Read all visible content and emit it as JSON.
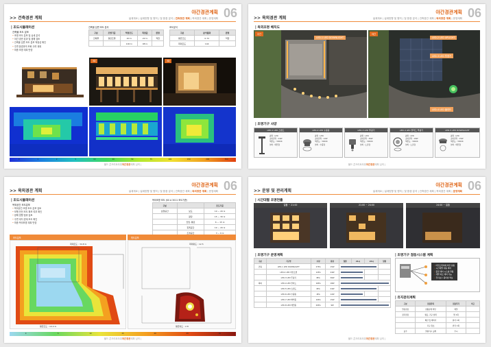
{
  "chapter_title": "야간경관계획",
  "chapter_number": "06",
  "nav": [
    "설계개요",
    "설계방향 및 원칙",
    "빛 환경 분석",
    "건축경관 계획",
    "옥외경관 계획",
    "운영계획"
  ],
  "footer": {
    "prefix": "올드 콘크리트타워",
    "highlight": "야간경관",
    "suffix": "계획 심의",
    "page": "|"
  },
  "page1": {
    "section": ">> 건축경관 계획",
    "sub": "| 조도시뮬레이션",
    "sub2": "건축물 조도 분포",
    "bullets": [
      "조명 조도 분포 및 상세 분석",
      "야간 경관 효과 및 광해 검토",
      "건축물 입면 조도 분포 적정성 확인",
      "주변 환경과의 조화 고려 계획",
      "최종 조명 계획 반영"
    ],
    "table1_title": "건축물 입면 조도 분석",
    "table1_head": [
      "구분",
      "조명기준",
      "적정조도",
      "측정값",
      "판정"
    ],
    "table1_rows": [
      [
        "건축물",
        "경관조명",
        "20 lx",
        "22 lx",
        "적합"
      ],
      [
        "",
        "",
        "100 lx",
        "98 lx",
        ""
      ]
    ],
    "table2_title": "조도분석",
    "table2_head": [
      "구분",
      "분석결과",
      "판정"
    ],
    "table2_rows": [
      [
        "평균조도",
        "0.72",
        "적합"
      ],
      [
        "최대조도",
        "144",
        ""
      ]
    ],
    "scale": [
      "0",
      "1",
      "2",
      "5",
      "10",
      "20",
      "50",
      "75",
      "100",
      "150",
      "200",
      "500"
    ]
  },
  "page2": {
    "section": ">> 옥외경관 계획",
    "sub": "| 옥외조명 배치도",
    "plabel_left": "주간",
    "plabel_right": "야간",
    "callouts": [
      "LED-1 LED DOWNLIGHT",
      "LED-2 LED UPLIGHT",
      "LED-3 LED 투광기",
      "LED-4 LED 볼라드"
    ],
    "sub2": "| 조명기구 사양",
    "cards": [
      {
        "title": "LED-1 LED 스탠드",
        "specs": [
          "광원 : LED",
          "소비전력 : 24W",
          "색온도 : 3000K",
          "설치 : 매입형"
        ]
      },
      {
        "title": "LED-2 LED 수중등",
        "specs": [
          "광원 : LED",
          "소비전력 : 12W",
          "색온도 : 3000K",
          "설치 : 수중형"
        ]
      },
      {
        "title": "LED-3 LED 투광기",
        "specs": [
          "광원 : LED",
          "소비전력 : 36W",
          "색온도 : 3000K",
          "설치 : 노출형"
        ]
      },
      {
        "title": "LED-4 LED 볼라드 투광기",
        "specs": [
          "광원 : LED",
          "소비전력 : 18W",
          "색온도 : 3000K",
          "설치 : 노출형"
        ]
      },
      {
        "title": "LED-5 LED DOWNLIGHT",
        "specs": [
          "광원 : LED",
          "소비전력 : 15W",
          "색온도 : 3000K",
          "설치 : 매입형"
        ]
      }
    ]
  },
  "page3": {
    "section": ">> 옥외경관 계획",
    "sub": "| 조도시뮬레이션",
    "sub2": "옥외공간 조도분포",
    "bullets": [
      "옥외공간 조명 조도 분포 검토",
      "보행 안전 조도 확보 여부 확인",
      "광해 영향 범위 검토",
      "주변 대지 경계 조도 확인",
      "최종 옥외조명 계획 반영"
    ],
    "table_title": "옥외조명 조도 (KS A 3011 조도기준)",
    "table_head": [
      "구분",
      "",
      "조도기준"
    ],
    "table_rows": [
      [
        "보행공간",
        "보도",
        "10 ~ 20 lx"
      ],
      [
        "",
        "광장",
        "15 ~ 30 lx"
      ],
      [
        "",
        "진입, 통로",
        "6 ~ 15 lx"
      ],
      [
        "",
        "휴게공간",
        "10 ~ 20 lx"
      ],
      [
        "",
        "조경공간",
        "3 ~ 6 lx"
      ]
    ],
    "left_label": "조도분포",
    "right_label": "휘도분포",
    "left_note_top": "최대조도 : 34.8 lx",
    "left_note_bottom": "평균조도 : 10.4 lx",
    "right_note_top": "최대휘도 : 12.5",
    "right_note_bottom": "평균휘도 : 2.8",
    "scale": [
      "0",
      "5",
      "10",
      "15",
      "20",
      "25",
      "30"
    ]
  },
  "page4": {
    "section": ">> 운영 및 관리계획",
    "sub": "| 시간대별 조명연출",
    "times": [
      "일몰 ~ 21:00",
      "21:00 ~ 24:00",
      "24:00 ~ 일출"
    ],
    "sub2": "| 조명기구 운영계획",
    "sub3": "| 조명기구 점등시스템 계획",
    "sub4": "| 유지관리계획",
    "op_head": [
      "구분",
      "기구명",
      "수량",
      "용량",
      "점등 계획"
    ],
    "op_cols": [
      "일몰",
      "21시",
      "24시",
      "일출"
    ],
    "op_rows": [
      [
        "건축",
        "LED-1 LED DOWNLIGHT",
        "27EA",
        "15W"
      ],
      [
        "",
        "LED-2 LED 라인조명",
        "12EA",
        "24W"
      ],
      [
        "",
        "LED-3 LED 투광기",
        "8EA",
        "36W"
      ],
      [
        "옥외",
        "LED-4 LED 볼라드",
        "16EA",
        "18W"
      ],
      [
        "",
        "LED-5 LED 스탠드",
        "6EA",
        "24W"
      ],
      [
        "",
        "LED-6 LED 수중등",
        "4EA",
        "12W"
      ],
      [
        "",
        "LED-7 LED 벽부등",
        "10EA",
        "15W"
      ],
      [
        "",
        "LED-8 LED 매입등",
        "20EA",
        "9W"
      ]
    ],
    "control_notes": [
      "타임스위치에 의한 점등",
      "시간대별 자동 제어",
      "중앙 제어 시스템 연동",
      "개별 회로 제어 가능",
      "유지보수 용이성 확보"
    ],
    "maint_head": [
      "구분",
      "점검항목",
      "점검주기",
      "비고"
    ],
    "maint_rows": [
      [
        "일상점검",
        "점등상태 확인",
        "매일",
        ""
      ],
      [
        "정기점검",
        "램프, 기구 상태",
        "월 1회",
        ""
      ],
      [
        "",
        "배선 및 제어기",
        "분기 1회",
        ""
      ],
      [
        "",
        "기구 청소",
        "반기 1회",
        ""
      ],
      [
        "보수",
        "불량기구 교체",
        "수시",
        ""
      ]
    ]
  }
}
